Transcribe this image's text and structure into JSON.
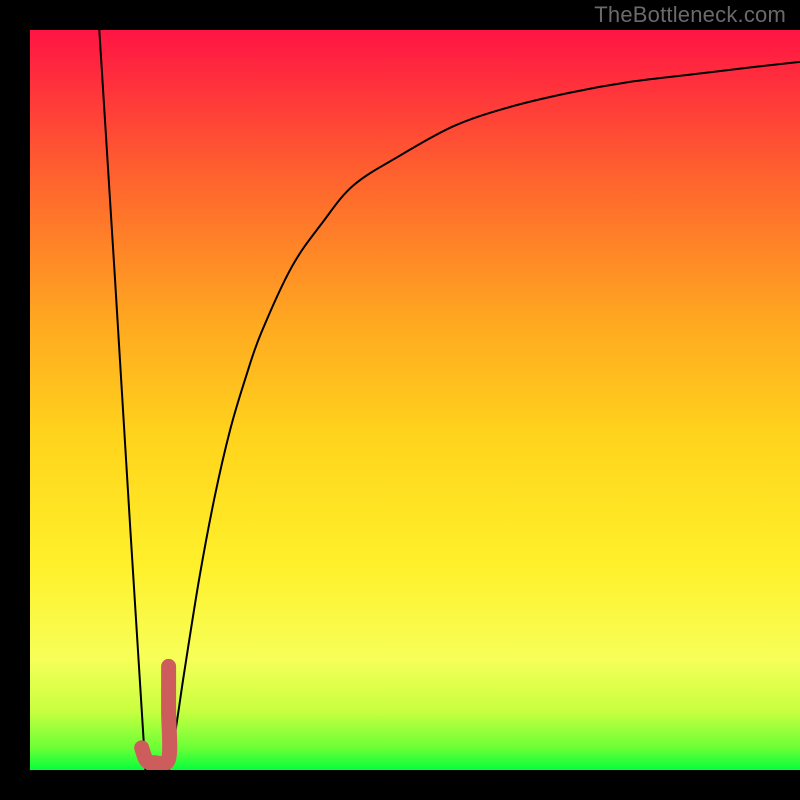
{
  "watermark": "TheBottleneck.com",
  "colors": {
    "gradient_top": "#ff1040",
    "gradient_mid1": "#ff9122",
    "gradient_mid2": "#ffe322",
    "gradient_mid3": "#f8ff55",
    "gradient_bottom": "#05ff3b",
    "curve": "#000000",
    "marker": "#cd5c5c",
    "marker_outline": "#a94442"
  },
  "chart_data": {
    "type": "line",
    "title": "",
    "xlabel": "",
    "ylabel": "",
    "xlim": [
      0,
      100
    ],
    "ylim": [
      0,
      100
    ],
    "grid": false,
    "annotations": [],
    "series": [
      {
        "name": "left-branch",
        "x": [
          9,
          11,
          13,
          15
        ],
        "values": [
          100,
          67,
          33,
          0
        ]
      },
      {
        "name": "right-branch",
        "x": [
          18,
          19,
          20,
          22,
          24,
          26,
          28,
          30,
          34,
          38,
          42,
          48,
          55,
          62,
          70,
          78,
          86,
          94,
          100
        ],
        "values": [
          0,
          6,
          13,
          26,
          37,
          46,
          53,
          59,
          68,
          74,
          79,
          83,
          87,
          89.5,
          91.5,
          93,
          94,
          95,
          95.7
        ]
      }
    ],
    "marker": {
      "name": "J-marker",
      "x": [
        14.5,
        15,
        15.5,
        16,
        18,
        18,
        18
      ],
      "values": [
        3,
        1.5,
        1,
        1,
        1.5,
        8,
        14
      ]
    },
    "background_gradient": {
      "direction": "vertical",
      "stops": [
        {
          "offset": 0.0,
          "hex": "#ff1444"
        },
        {
          "offset": 0.2,
          "hex": "#ff632e"
        },
        {
          "offset": 0.4,
          "hex": "#ffaa20"
        },
        {
          "offset": 0.55,
          "hex": "#ffd41c"
        },
        {
          "offset": 0.72,
          "hex": "#fff02a"
        },
        {
          "offset": 0.85,
          "hex": "#f7ff58"
        },
        {
          "offset": 0.92,
          "hex": "#c8ff40"
        },
        {
          "offset": 0.97,
          "hex": "#6cff36"
        },
        {
          "offset": 1.0,
          "hex": "#05ff3b"
        }
      ]
    }
  }
}
